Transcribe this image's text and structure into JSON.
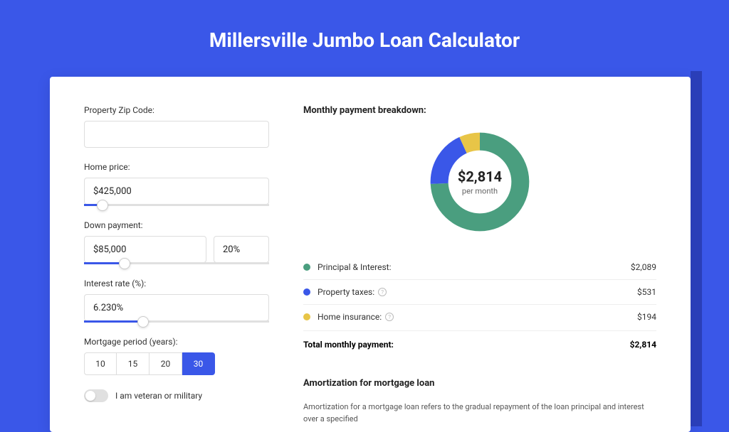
{
  "title": "Millersville Jumbo Loan Calculator",
  "form": {
    "zip_label": "Property Zip Code:",
    "zip_value": "",
    "price_label": "Home price:",
    "price_value": "$425,000",
    "price_slider_pct": 10,
    "down_label": "Down payment:",
    "down_value": "$85,000",
    "down_pct": "20%",
    "down_slider_pct": 22,
    "rate_label": "Interest rate (%):",
    "rate_value": "6.230%",
    "rate_slider_pct": 32,
    "period_label": "Mortgage period (years):",
    "periods": [
      "10",
      "15",
      "20",
      "30"
    ],
    "period_active": "30",
    "veteran_label": "I am veteran or military"
  },
  "breakdown": {
    "title": "Monthly payment breakdown:",
    "center_value": "$2,814",
    "center_sub": "per month",
    "items": [
      {
        "label": "Principal & Interest:",
        "color": "#4a9e7f",
        "amount": "$2,089",
        "info": false
      },
      {
        "label": "Property taxes:",
        "color": "#3a57e8",
        "amount": "$531",
        "info": true
      },
      {
        "label": "Home insurance:",
        "color": "#e8c547",
        "amount": "$194",
        "info": true
      }
    ],
    "total_label": "Total monthly payment:",
    "total_value": "$2,814"
  },
  "amort": {
    "title": "Amortization for mortgage loan",
    "text": "Amortization for a mortgage loan refers to the gradual repayment of the loan principal and interest over a specified"
  },
  "chart_data": {
    "type": "pie",
    "title": "Monthly payment breakdown",
    "series": [
      {
        "name": "Principal & Interest",
        "value": 2089,
        "color": "#4a9e7f"
      },
      {
        "name": "Property taxes",
        "value": 531,
        "color": "#3a57e8"
      },
      {
        "name": "Home insurance",
        "value": 194,
        "color": "#e8c547"
      }
    ],
    "total": 2814,
    "center_label": "$2,814 per month"
  }
}
